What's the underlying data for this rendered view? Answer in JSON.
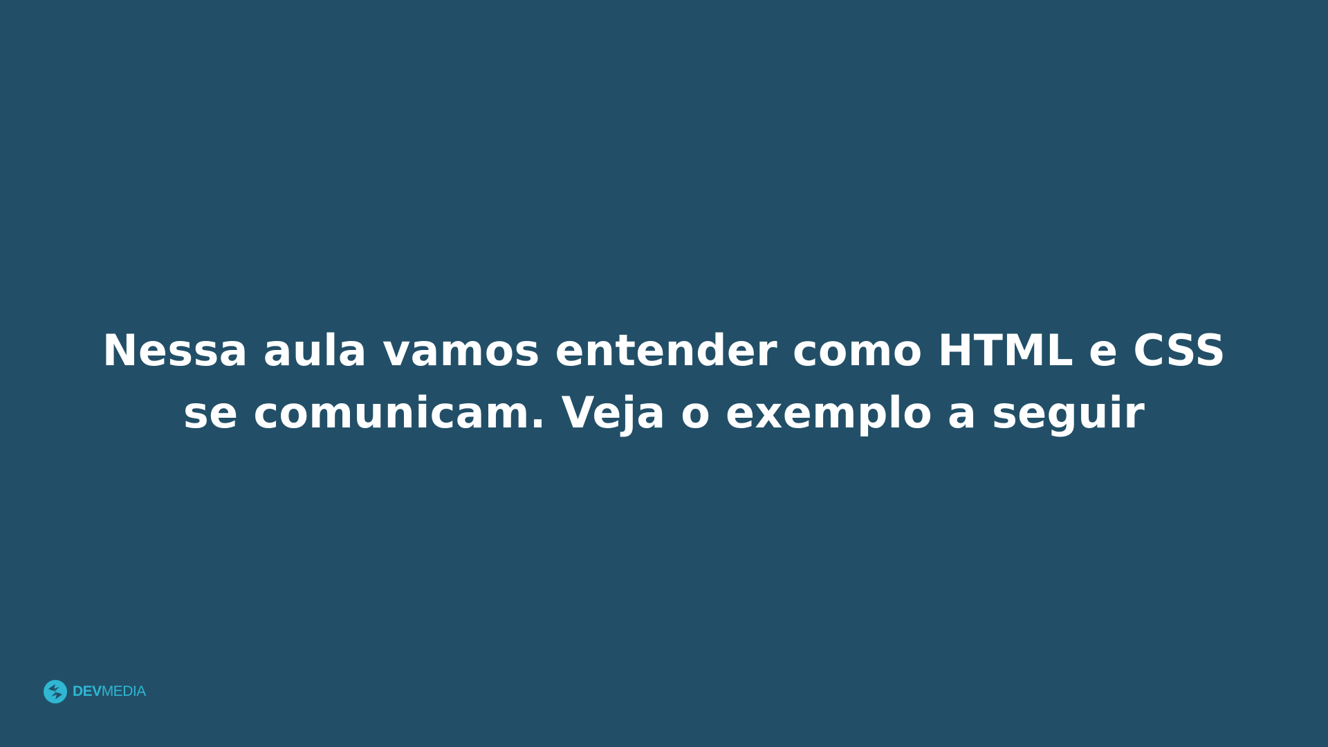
{
  "slide": {
    "headline_line_1": "Nessa aula vamos entender como HTML e CSS",
    "headline_line_2": "se comunicam. Veja o exemplo a seguir",
    "background_color": "#224f67",
    "text_color": "#ffffff"
  },
  "brand": {
    "icon": "devmedia-logo-icon",
    "name_bold": "DEV",
    "name_light": "MEDIA",
    "color": "#2fb7d3"
  }
}
